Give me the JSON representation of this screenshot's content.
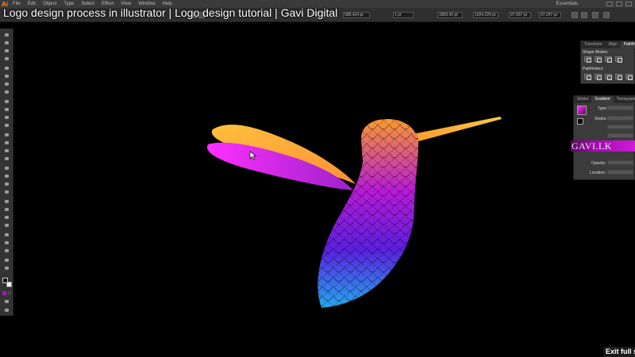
{
  "video_title": "Logo design process in illustrator | Logo design tutorial | Gavi Digital",
  "menubar": {
    "logo": "Ai",
    "items": [
      "File",
      "Edit",
      "Object",
      "Type",
      "Select",
      "Effect",
      "View",
      "Window",
      "Help"
    ],
    "workspace": "Essentials"
  },
  "controlbar": {
    "fields": [
      "605.512 pt",
      "588.424 pt",
      "1 pt",
      "1850.43 pt",
      "1024.229 pt",
      "97.937 pt",
      "97.247 pt"
    ]
  },
  "panels": {
    "pathfinder": {
      "tabs": [
        "Transform",
        "Align",
        "Pathfinder"
      ],
      "active_tab": "Pathfinder",
      "shape_modes_label": "Shape Modes:",
      "pathfinders_label": "Pathfinders:"
    },
    "gradient": {
      "tabs": [
        "Stroke",
        "Gradient",
        "Transparency"
      ],
      "active_tab": "Gradient",
      "type_label": "Type:",
      "stroke_label": "Stroke:",
      "opacity_label": "Opacity:",
      "location_label": "Location:"
    }
  },
  "watermark": "GAVI.LK",
  "exit_fullscreen_label": "Exit full s",
  "colors": {
    "bird_top": "#ffa126",
    "bird_middle": "#b81bd6",
    "bird_lower": "#5a1fe0",
    "bird_bottom": "#1fb8f0",
    "wing_top": "#ffc03a",
    "wing_bottom": "#ff2fff",
    "beak": "#ffb12f"
  }
}
